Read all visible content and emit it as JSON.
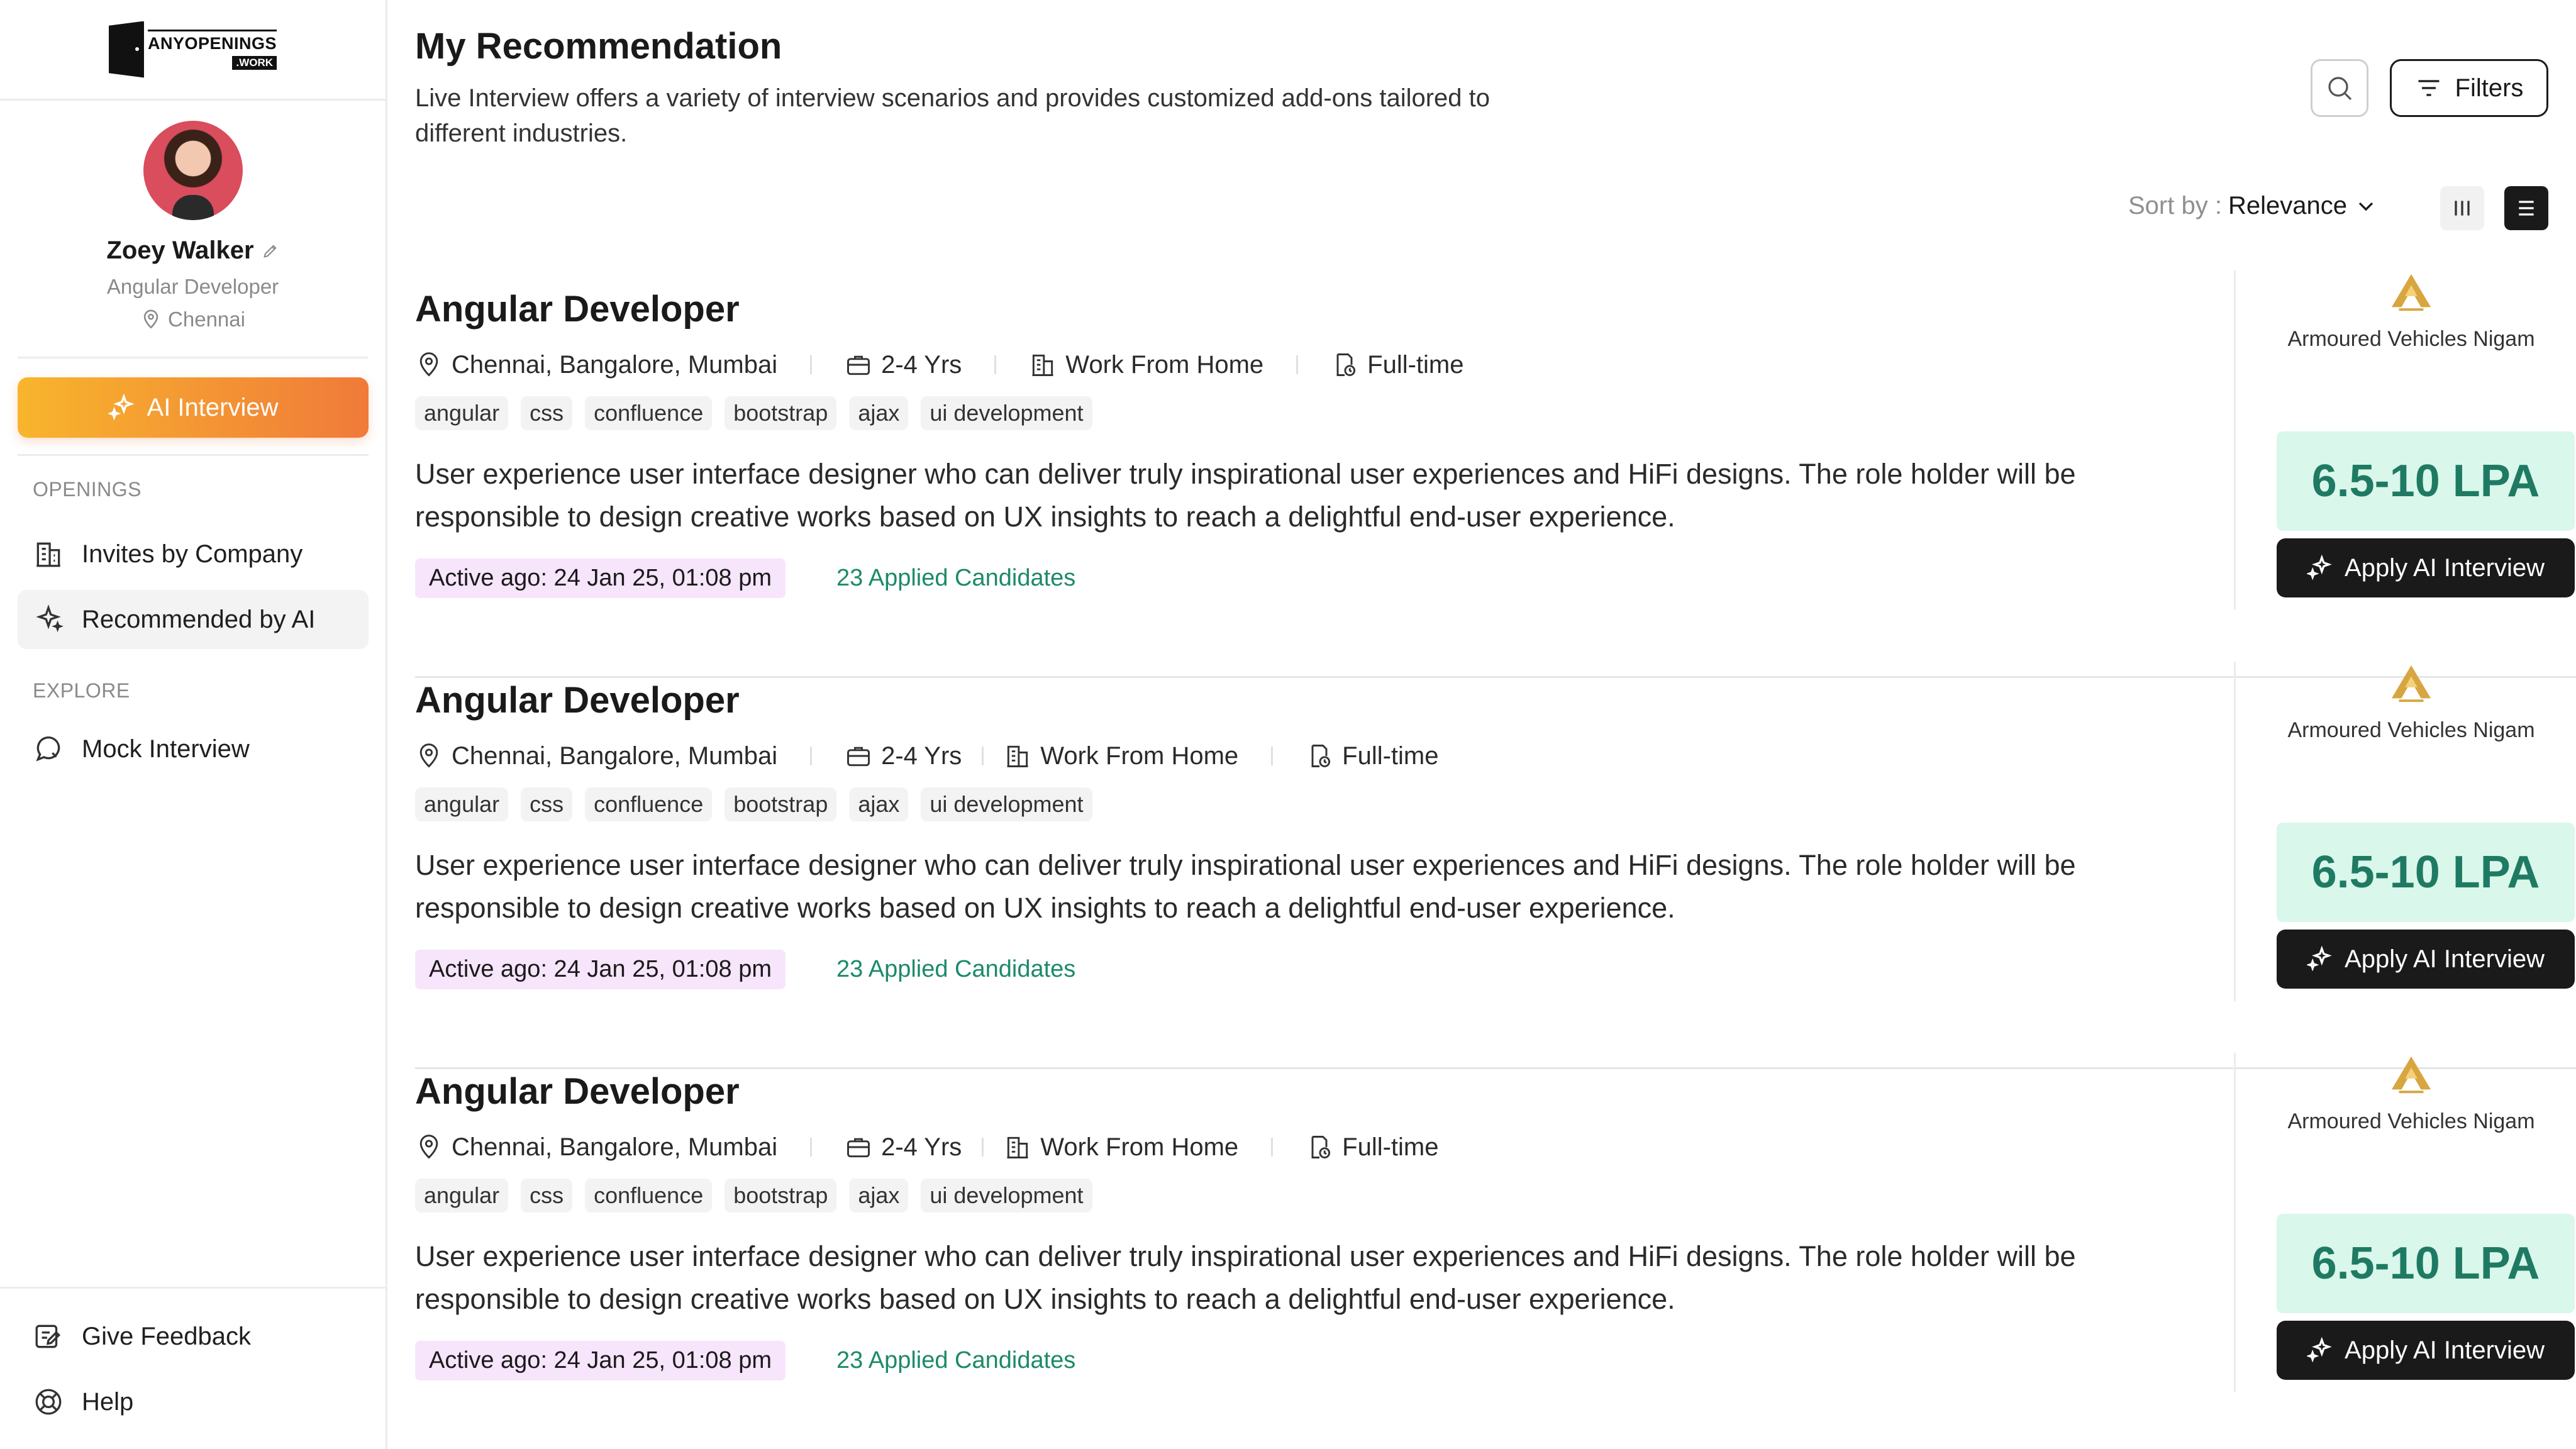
{
  "brand": {
    "logo_main": "ANYOPENINGS",
    "logo_sub": ".WORK"
  },
  "profile": {
    "name": "Zoey Walker",
    "role": "Angular Developer",
    "location": "Chennai"
  },
  "sidebar": {
    "ai_interview_label": "AI Interview",
    "openings_label": "OPENINGS",
    "items": [
      {
        "label": "Invites by Company",
        "icon": "building-icon",
        "active": false
      },
      {
        "label": "Recommended by AI",
        "icon": "sparkle-icon",
        "active": true
      }
    ],
    "explore_label": "EXPLORE",
    "explore_items": [
      {
        "label": "Mock Interview",
        "icon": "chat-icon"
      }
    ],
    "bottom_items": [
      {
        "label": "Give Feedback",
        "icon": "feedback-icon"
      },
      {
        "label": "Help",
        "icon": "help-icon"
      }
    ]
  },
  "header": {
    "title": "My Recommendation",
    "description": "Live Interview offers a variety of interview scenarios and provides customized add-ons tailored to different industries.",
    "filters_label": "Filters",
    "sort_label": "Sort by :",
    "sort_value": "Relevance"
  },
  "jobs": [
    {
      "title": "Angular Developer",
      "location": "Chennai, Bangalore, Mumbai",
      "experience": "2-4 Yrs",
      "work_mode": "Work From Home",
      "type": "Full-time",
      "tags": [
        "angular",
        "css",
        "confluence",
        "bootstrap",
        "ajax",
        "ui development"
      ],
      "description": "User experience user interface designer who can deliver truly inspirational user experiences and HiFi designs. The role holder will be responsible to design creative works based on UX insights to reach a delightful end-user experience.",
      "active": "Active ago: 24 Jan 25, 01:08 pm",
      "applied": "23 Applied Candidates",
      "company": "Armoured Vehicles Nigam",
      "salary": "6.5-10 LPA",
      "apply_label": "Apply AI Interview"
    },
    {
      "title": "Angular Developer",
      "location": "Chennai, Bangalore, Mumbai",
      "experience": "2-4 Yrs",
      "work_mode": "Work From Home",
      "type": "Full-time",
      "tags": [
        "angular",
        "css",
        "confluence",
        "bootstrap",
        "ajax",
        "ui development"
      ],
      "description": "User experience user interface designer who can deliver truly inspirational user experiences and HiFi designs. The role holder will be responsible to design creative works based on UX insights to reach a delightful end-user experience.",
      "active": "Active ago: 24 Jan 25, 01:08 pm",
      "applied": "23 Applied Candidates",
      "company": "Armoured Vehicles Nigam",
      "salary": "6.5-10 LPA",
      "apply_label": "Apply AI Interview"
    },
    {
      "title": "Angular Developer",
      "location": "Chennai, Bangalore, Mumbai",
      "experience": "2-4 Yrs",
      "work_mode": "Work From Home",
      "type": "Full-time",
      "tags": [
        "angular",
        "css",
        "confluence",
        "bootstrap",
        "ajax",
        "ui development"
      ],
      "description": "User experience user interface designer who can deliver truly inspirational user experiences and HiFi designs. The role holder will be responsible to design creative works based on UX insights to reach a delightful end-user experience.",
      "active": "Active ago: 24 Jan 25, 01:08 pm",
      "applied": "23 Applied Candidates",
      "company": "Armoured Vehicles Nigam",
      "salary": "6.5-10 LPA",
      "apply_label": "Apply AI Interview"
    }
  ],
  "colors": {
    "accent_start": "#f8b52c",
    "accent_end": "#f07a3a",
    "salary_bg": "#d9f7ea",
    "salary_text": "#1f7a63",
    "applied_text": "#1c8a6a",
    "active_bg": "#f6e5fb"
  }
}
